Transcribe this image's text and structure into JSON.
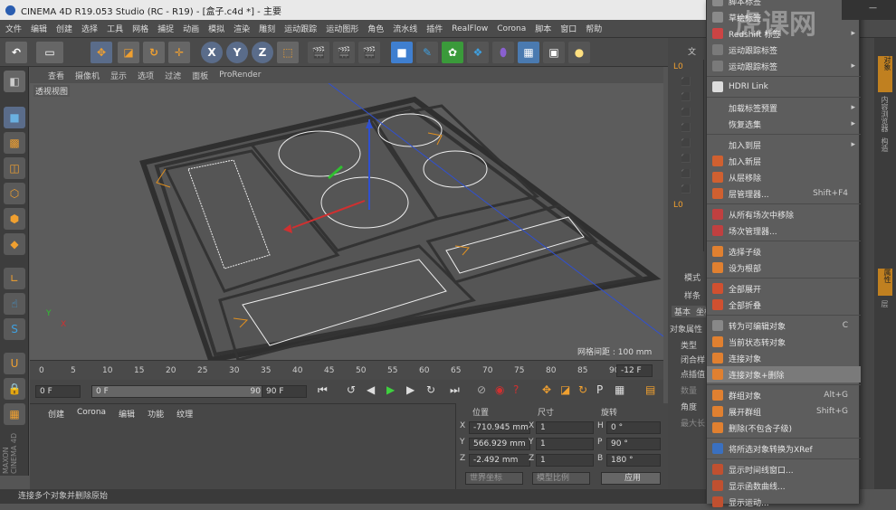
{
  "title": "CINEMA 4D R19.053 Studio (RC - R19) - [盒子.c4d *] - 主要",
  "menu": [
    "文件",
    "编辑",
    "创建",
    "选择",
    "工具",
    "网格",
    "捕捉",
    "动画",
    "模拟",
    "渲染",
    "雕刻",
    "运动跟踪",
    "运动图形",
    "角色",
    "流水线",
    "插件",
    "RealFlow",
    "Corona",
    "脚本",
    "窗口",
    "帮助"
  ],
  "toolbar": {
    "xyz": [
      "X",
      "Y",
      "Z"
    ]
  },
  "viewport": {
    "menu": [
      "查看",
      "摄像机",
      "显示",
      "选项",
      "过滤",
      "面板",
      "ProRender"
    ],
    "label": "透视视图",
    "grid": "网格间距 : 100 mm",
    "axis": [
      "Y",
      "X"
    ]
  },
  "timeline": {
    "ticks": [
      "0",
      "5",
      "10",
      "15",
      "20",
      "25",
      "30",
      "35",
      "40",
      "45",
      "50",
      "55",
      "60",
      "65",
      "70",
      "75",
      "80",
      "85",
      "90"
    ],
    "frame": "-12 F"
  },
  "playback": {
    "start": "0 F",
    "range_start": "0 F",
    "range_end": "90 F",
    "end": "90 F"
  },
  "bottom": {
    "menu": [
      "创建",
      "Corona",
      "编辑",
      "功能",
      "纹理"
    ]
  },
  "coords": {
    "headers": [
      "位置",
      "尺寸",
      "旋转"
    ],
    "rows": [
      {
        "axis": "X",
        "pos": "-710.945 mm",
        "size": "1",
        "rl": "H",
        "rot": "0 °"
      },
      {
        "axis": "Y",
        "pos": "566.929 mm",
        "size": "1",
        "rl": "P",
        "rot": "90 °"
      },
      {
        "axis": "Z",
        "pos": "-2.492 mm",
        "size": "1",
        "rl": "B",
        "rot": "180 °"
      }
    ],
    "mode1": "世界坐标",
    "mode2": "模型比例",
    "apply": "应用"
  },
  "right": {
    "tab": "文",
    "mode": "模式",
    "obj": "样条",
    "tabs": [
      "基本",
      "坐标"
    ],
    "props": "对象属性",
    "fields": [
      "类型",
      "闭合样",
      "点插值",
      "数量",
      "角度",
      "最大长"
    ],
    "side": [
      "对象",
      "内容浏览器",
      "构造",
      "属性",
      "层"
    ]
  },
  "status": "连接多个对象并删除原始",
  "watermark": "虎课网",
  "menu_items": [
    {
      "label": "脚本标签",
      "arrow": "▸",
      "color": "#8a8a8a"
    },
    {
      "label": "草绘标签",
      "arrow": "▸",
      "color": "#8a8a8a"
    },
    {
      "label": "Redshift 标签",
      "arrow": "▸",
      "color": "#c44"
    },
    {
      "label": "运动跟踪标签",
      "arrow": "",
      "color": "#7a7a7a"
    },
    {
      "label": "运动跟踪标签",
      "arrow": "▸",
      "color": "#7a7a7a"
    },
    {
      "label": "HDRI Link",
      "arrow": "",
      "color": "#ddd"
    },
    {
      "label": "加载标签预置",
      "arrow": "▸",
      "color": ""
    },
    {
      "label": "恢复选集",
      "arrow": "▸",
      "color": ""
    },
    {
      "label": "加入到层",
      "arrow": "▸",
      "color": ""
    },
    {
      "label": "加入新层",
      "shortcut": "",
      "color": "#d06030"
    },
    {
      "label": "从层移除",
      "color": "#d06030"
    },
    {
      "label": "层管理器...",
      "shortcut": "Shift+F4",
      "color": "#d06030"
    },
    {
      "label": "从所有场次中移除",
      "color": "#c04040"
    },
    {
      "label": "场次管理器...",
      "color": "#c04040"
    },
    {
      "label": "选择子级",
      "color": "#e08030"
    },
    {
      "label": "设为根部",
      "color": "#e08030"
    },
    {
      "label": "全部展开",
      "color": "#d05030"
    },
    {
      "label": "全部折叠",
      "color": "#d05030"
    },
    {
      "label": "转为可编辑对象",
      "shortcut": "C",
      "color": "#888"
    },
    {
      "label": "当前状态转对象",
      "color": "#e08030"
    },
    {
      "label": "连接对象",
      "color": "#e08030"
    },
    {
      "label": "连接对象+删除",
      "color": "#e08030"
    },
    {
      "label": "群组对象",
      "shortcut": "Alt+G",
      "color": "#e08030"
    },
    {
      "label": "展开群组",
      "shortcut": "Shift+G",
      "color": "#e08030"
    },
    {
      "label": "删除(不包含子级)",
      "color": "#e08030"
    },
    {
      "label": "将所选对象转换为XRef",
      "color": "#3a70c0"
    },
    {
      "label": "显示时间线窗口...",
      "color": "#c05030"
    },
    {
      "label": "显示函数曲线...",
      "color": "#c05030"
    },
    {
      "label": "显示运动...",
      "color": "#c05030"
    }
  ]
}
